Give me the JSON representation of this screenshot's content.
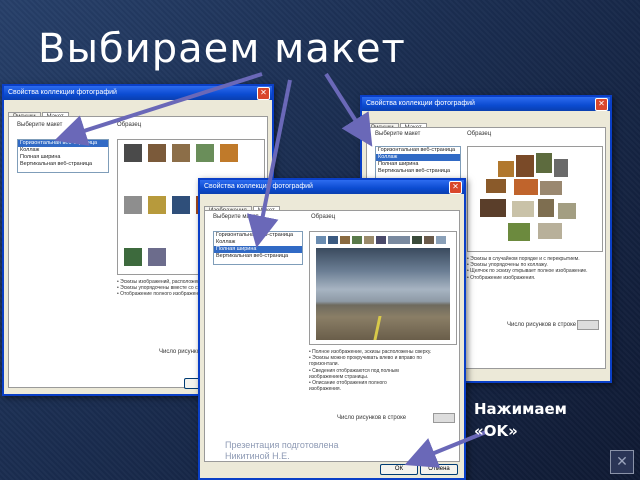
{
  "slide": {
    "title": "Выбираем макет",
    "caption_line1": "Нажимаем",
    "caption_line2": "«OK»",
    "footer_line1": "Презентация подготовлена",
    "footer_line2": "Никитиной Н.Е.",
    "nav_icon": "close-x-icon"
  },
  "dialog1": {
    "title": "Свойства коллекции фотографий",
    "tabs": [
      "Рисунки",
      "Макет"
    ],
    "choose_label": "Выберите макет",
    "sample_label": "Образец",
    "layouts": [
      "Горизонтальная веб-страница",
      "Коллаж",
      "Полная ширина",
      "Вертикальная веб-страница"
    ],
    "selected_index": 0,
    "desc": [
      "• Эскизы изображений, расположенные вертикально.",
      "• Эскизы упорядочены вместе со сведениями.",
      "• Отображение полного изображения."
    ],
    "bottom_label": "Число рисунков"
  },
  "dialog2": {
    "title": "Свойства коллекции фотографий",
    "tabs": [
      "Рисунки",
      "Макет"
    ],
    "choose_label": "Выберите макет",
    "sample_label": "Образец",
    "layouts": [
      "Горизонтальная веб-страница",
      "Коллаж",
      "Полная ширина",
      "Вертикальная веб-страница"
    ],
    "selected_index": 1,
    "desc": [
      "• Эскизы в случайном порядке и с перекрытием.",
      "• Эскизы упорядочены по коллажу.",
      "• Щелчок по эскизу открывает полное изображение.",
      "• Отображение изображения."
    ],
    "bottom_label": "Число рисунков в строке"
  },
  "dialog3": {
    "title": "Свойства коллекции фотографий",
    "tabs": [
      "Изображения",
      "Макет"
    ],
    "choose_label": "Выберите макет",
    "sample_label": "Образец",
    "layouts": [
      "Горизонтальная веб-страница",
      "Коллаж",
      "Полная ширина",
      "Вертикальная веб-страница"
    ],
    "selected_index": 2,
    "desc": [
      "• Полное изображение, эскизы расположены сверху.",
      "• Эскизы можно прокручивать влево и вправо по",
      "горизонтали.",
      "• Сведения отображаются под полным",
      "изображением страницы.",
      "• Описание отображения полного",
      "изображения."
    ],
    "bottom_label": "Число рисунков в строке",
    "ok_label": "ОК",
    "cancel_label": "Отмена"
  },
  "colors": {
    "selection": "#316ac5",
    "titlebar": "#0b4bd0",
    "arrow": "#6a68b8"
  }
}
